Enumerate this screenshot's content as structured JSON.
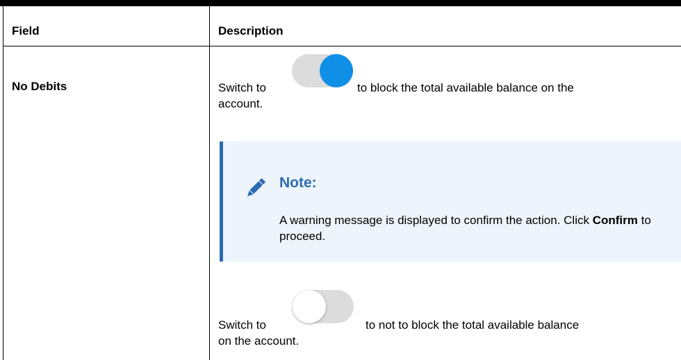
{
  "table": {
    "header": {
      "field": "Field",
      "description": "Description"
    },
    "row": {
      "field": "No Debits",
      "on_switch": {
        "prefix": "Switch to",
        "suffix_line1": "to block the total available balance on the",
        "suffix_line2": "account."
      },
      "note": {
        "icon": "pencil-icon",
        "title": "Note:",
        "text_part1": "A warning message is displayed to confirm the action. Click ",
        "text_bold": "Confirm",
        "text_part2": " to proceed."
      },
      "off_switch": {
        "prefix": "Switch to",
        "suffix_line1": "to not to block the total available balance",
        "suffix_line2": "on the account."
      }
    }
  },
  "colors": {
    "toggle_on_knob": "#0f8fe6",
    "toggle_track": "#dcdcdc",
    "note_background": "#eef4fb",
    "note_accent": "#2d6bb1"
  }
}
